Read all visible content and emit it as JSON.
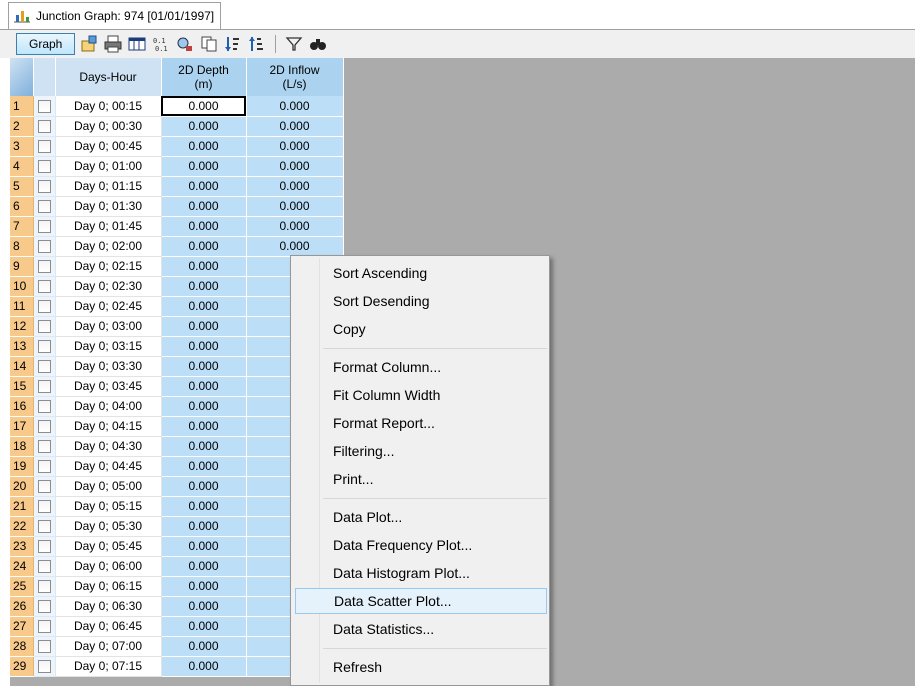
{
  "window": {
    "tab_title": "Junction Graph: 974 [01/01/1997]"
  },
  "toolbar": {
    "graph_label": "Graph",
    "icons": [
      "properties-icon",
      "print-icon",
      "table-icon",
      "columns-icon",
      "find-icon",
      "copy-icon",
      "sort-ascending-icon",
      "sort-descending-icon",
      "filter-icon",
      "binoculars-icon"
    ]
  },
  "grid": {
    "headers": {
      "days_hour": "Days-Hour",
      "depth_line1": "2D Depth",
      "depth_line2": "(m)",
      "inflow_line1": "2D Inflow",
      "inflow_line2": "(L/s)"
    },
    "rows": [
      {
        "n": "1",
        "t": "Day 0;  00:15",
        "d": "0.000",
        "i": "0.000"
      },
      {
        "n": "2",
        "t": "Day 0;  00:30",
        "d": "0.000",
        "i": "0.000"
      },
      {
        "n": "3",
        "t": "Day 0;  00:45",
        "d": "0.000",
        "i": "0.000"
      },
      {
        "n": "4",
        "t": "Day 0;  01:00",
        "d": "0.000",
        "i": "0.000"
      },
      {
        "n": "5",
        "t": "Day 0;  01:15",
        "d": "0.000",
        "i": "0.000"
      },
      {
        "n": "6",
        "t": "Day 0;  01:30",
        "d": "0.000",
        "i": "0.000"
      },
      {
        "n": "7",
        "t": "Day 0;  01:45",
        "d": "0.000",
        "i": "0.000"
      },
      {
        "n": "8",
        "t": "Day 0;  02:00",
        "d": "0.000",
        "i": "0.000"
      },
      {
        "n": "9",
        "t": "Day 0;  02:15",
        "d": "0.000",
        "i": ""
      },
      {
        "n": "10",
        "t": "Day 0;  02:30",
        "d": "0.000",
        "i": ""
      },
      {
        "n": "11",
        "t": "Day 0;  02:45",
        "d": "0.000",
        "i": ""
      },
      {
        "n": "12",
        "t": "Day 0;  03:00",
        "d": "0.000",
        "i": ""
      },
      {
        "n": "13",
        "t": "Day 0;  03:15",
        "d": "0.000",
        "i": ""
      },
      {
        "n": "14",
        "t": "Day 0;  03:30",
        "d": "0.000",
        "i": ""
      },
      {
        "n": "15",
        "t": "Day 0;  03:45",
        "d": "0.000",
        "i": ""
      },
      {
        "n": "16",
        "t": "Day 0;  04:00",
        "d": "0.000",
        "i": ""
      },
      {
        "n": "17",
        "t": "Day 0;  04:15",
        "d": "0.000",
        "i": ""
      },
      {
        "n": "18",
        "t": "Day 0;  04:30",
        "d": "0.000",
        "i": ""
      },
      {
        "n": "19",
        "t": "Day 0;  04:45",
        "d": "0.000",
        "i": ""
      },
      {
        "n": "20",
        "t": "Day 0;  05:00",
        "d": "0.000",
        "i": ""
      },
      {
        "n": "21",
        "t": "Day 0;  05:15",
        "d": "0.000",
        "i": ""
      },
      {
        "n": "22",
        "t": "Day 0;  05:30",
        "d": "0.000",
        "i": ""
      },
      {
        "n": "23",
        "t": "Day 0;  05:45",
        "d": "0.000",
        "i": ""
      },
      {
        "n": "24",
        "t": "Day 0;  06:00",
        "d": "0.000",
        "i": ""
      },
      {
        "n": "25",
        "t": "Day 0;  06:15",
        "d": "0.000",
        "i": ""
      },
      {
        "n": "26",
        "t": "Day 0;  06:30",
        "d": "0.000",
        "i": ""
      },
      {
        "n": "27",
        "t": "Day 0;  06:45",
        "d": "0.000",
        "i": ""
      },
      {
        "n": "28",
        "t": "Day 0;  07:00",
        "d": "0.000",
        "i": ""
      },
      {
        "n": "29",
        "t": "Day 0;  07:15",
        "d": "0.000",
        "i": ""
      }
    ]
  },
  "context_menu": {
    "items": [
      {
        "label": "Sort Ascending",
        "name": "menu-sort-ascending"
      },
      {
        "label": "Sort Desending",
        "name": "menu-sort-descending"
      },
      {
        "label": "Copy",
        "name": "menu-copy"
      },
      {
        "label": "Format Column...",
        "name": "menu-format-column"
      },
      {
        "label": "Fit Column Width",
        "name": "menu-fit-column-width"
      },
      {
        "label": "Format Report...",
        "name": "menu-format-report"
      },
      {
        "label": "Filtering...",
        "name": "menu-filtering"
      },
      {
        "label": "Print...",
        "name": "menu-print"
      },
      {
        "label": "Data Plot...",
        "name": "menu-data-plot"
      },
      {
        "label": "Data Frequency Plot...",
        "name": "menu-data-frequency-plot"
      },
      {
        "label": "Data Histogram Plot...",
        "name": "menu-data-histogram-plot"
      },
      {
        "label": "Data Scatter Plot...",
        "name": "menu-data-scatter-plot",
        "hover": true
      },
      {
        "label": "Data Statistics...",
        "name": "menu-data-statistics"
      },
      {
        "label": "Refresh",
        "name": "menu-refresh"
      }
    ]
  },
  "colors": {
    "row_number_bg": "#f7c98a",
    "value_cell_bg": "#bcdff7",
    "header_bg": "#cfe2f3",
    "empty_area_bg": "#ababab",
    "menu_hover_bg": "#e5f1fb"
  }
}
